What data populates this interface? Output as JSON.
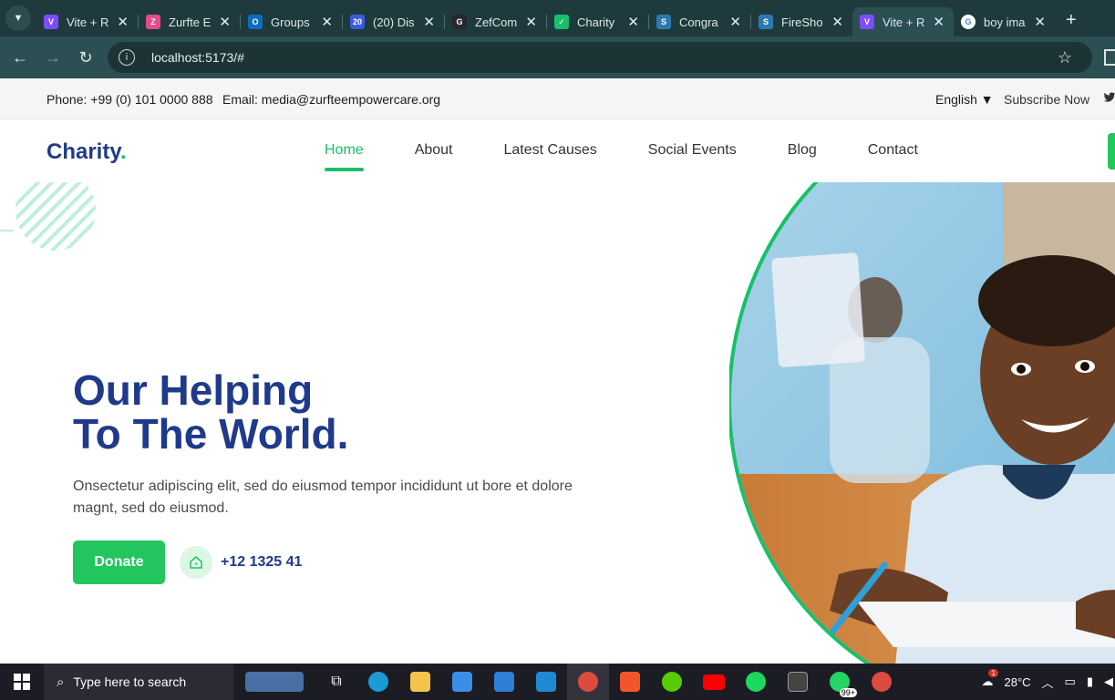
{
  "browser": {
    "tabs": [
      {
        "title": "Vite + R",
        "color": "#7c4dff",
        "glyph": "V"
      },
      {
        "title": "Zurfte E",
        "color": "#e64a8f",
        "glyph": "Z"
      },
      {
        "title": "Groups",
        "color": "#0f6cbd",
        "glyph": "O"
      },
      {
        "title": "(20) Dis",
        "color": "#3b5bdb",
        "glyph": "20"
      },
      {
        "title": "ZefCom",
        "color": "#24292e",
        "glyph": "G"
      },
      {
        "title": "Charity",
        "color": "#1bbf6b",
        "glyph": "✓"
      },
      {
        "title": "Congra",
        "color": "#2a7ab0",
        "glyph": "S"
      },
      {
        "title": "FireSho",
        "color": "#2a7ab0",
        "glyph": "S"
      },
      {
        "title": "Vite + R",
        "color": "#7c4dff",
        "glyph": "V"
      },
      {
        "title": "boy ima",
        "color": "#ffffff",
        "glyph": "G"
      }
    ],
    "active_tab": 8,
    "url": "localhost:5173/#",
    "new_tab": "+"
  },
  "topbar": {
    "phone": "Phone: +99 (0) 101 0000 888",
    "email": "Email: media@zurfteempowercare.org",
    "language": "English ▼",
    "subscribe": "Subscribe Now"
  },
  "nav": {
    "logo": "Charity",
    "logo_dot": ".",
    "links": [
      "Home",
      "About",
      "Latest Causes",
      "Social Events",
      "Blog",
      "Contact"
    ],
    "active": "Home"
  },
  "hero": {
    "title_line1": "Our Helping",
    "title_line2": "To The World.",
    "description": "Onsectetur adipiscing elit, sed do eiusmod tempor incididunt ut bore et dolore magnt, sed do eiusmod.",
    "donate_label": "Donate",
    "phone": "+12 1325 41"
  },
  "taskbar": {
    "search_placeholder": "Type here to search",
    "temperature": "28°C",
    "whatsapp_badge": "99+",
    "weather_badge": "1"
  },
  "colors": {
    "brand_blue": "#1f3a8a",
    "brand_green": "#22c55e",
    "chrome_dark": "#1f3a3d"
  }
}
